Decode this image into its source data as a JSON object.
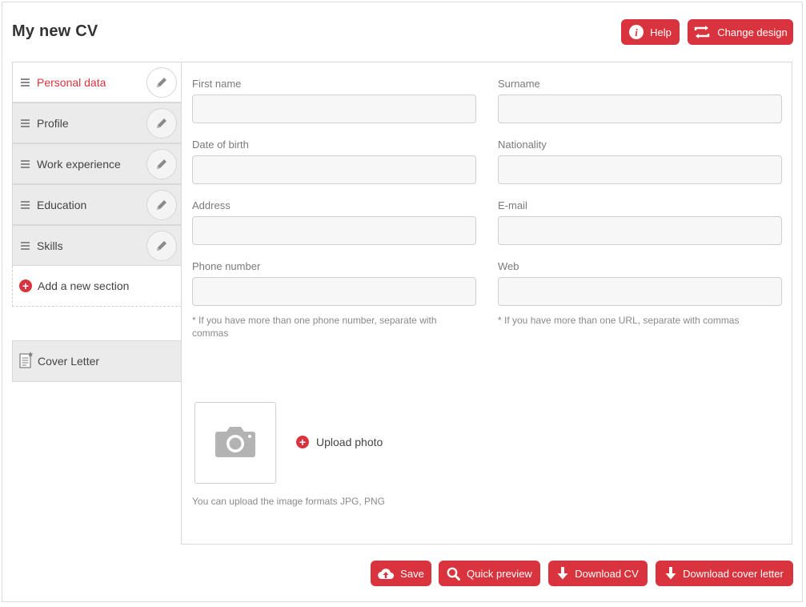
{
  "page": {
    "title": "My new CV"
  },
  "header": {
    "help_label": "Help",
    "change_design_label": "Change design"
  },
  "sidebar": {
    "items": [
      {
        "label": "Personal data",
        "active": true
      },
      {
        "label": "Profile",
        "active": false
      },
      {
        "label": "Work experience",
        "active": false
      },
      {
        "label": "Education",
        "active": false
      },
      {
        "label": "Skills",
        "active": false
      }
    ],
    "add_section_label": "Add a new section",
    "cover_letter_label": "Cover Letter"
  },
  "form": {
    "first_name": {
      "label": "First name",
      "value": ""
    },
    "surname": {
      "label": "Surname",
      "value": ""
    },
    "date_of_birth": {
      "label": "Date of birth",
      "value": ""
    },
    "nationality": {
      "label": "Nationality",
      "value": ""
    },
    "address": {
      "label": "Address",
      "value": ""
    },
    "email": {
      "label": "E-mail",
      "value": ""
    },
    "phone": {
      "label": "Phone number",
      "value": "",
      "hint": "* If you have more than one phone number, separate with commas"
    },
    "web": {
      "label": "Web",
      "value": "",
      "hint": "* If you have more than one URL, separate with commas"
    }
  },
  "photo": {
    "upload_label": "Upload photo",
    "formats_hint": "You can upload the image formats JPG, PNG"
  },
  "footer": {
    "save_label": "Save",
    "quick_preview_label": "Quick preview",
    "download_cv_label": "Download CV",
    "download_cover_letter_label": "Download cover letter"
  },
  "colors": {
    "accent": "#d9343e",
    "sidebar_bg": "#ebebeb",
    "input_bg": "#f7f7f7"
  },
  "icons": [
    "info-icon",
    "swap-icon",
    "drag-handle-icon",
    "pencil-icon",
    "plus-icon",
    "document-icon",
    "camera-icon",
    "cloud-upload-icon",
    "search-icon",
    "download-icon"
  ]
}
